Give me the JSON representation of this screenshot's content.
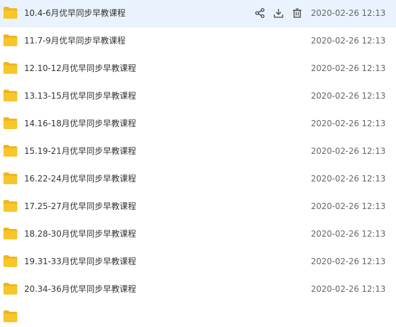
{
  "files": [
    {
      "name": "10.4-6月优早同步早教课程",
      "date": "2020-02-26 12:13"
    },
    {
      "name": "11.7-9月优早同步早教课程",
      "date": "2020-02-26 12:13"
    },
    {
      "name": "12.10-12月优早同步早教课程",
      "date": "2020-02-26 12:13"
    },
    {
      "name": "13.13-15月优早同步早教课程",
      "date": "2020-02-26 12:13"
    },
    {
      "name": "14.16-18月优早同步早教课程",
      "date": "2020-02-26 12:13"
    },
    {
      "name": "15.19-21月优早同步早教课程",
      "date": "2020-02-26 12:13"
    },
    {
      "name": "16.22-24月优早同步早教课程",
      "date": "2020-02-26 12:13"
    },
    {
      "name": "17.25-27月优早同步早教课程",
      "date": "2020-02-26 12:13"
    },
    {
      "name": "18.28-30月优早同步早教课程",
      "date": "2020-02-26 12:13"
    },
    {
      "name": "19.31-33月优早同步早教课程",
      "date": "2020-02-26 12:13"
    },
    {
      "name": "20.34-36月优早同步早教课程",
      "date": "2020-02-26 12:13"
    }
  ],
  "row_actions": {
    "share_icon": "share-icon",
    "download_icon": "download-icon",
    "delete_icon": "trash-icon"
  },
  "colors": {
    "folder": "#f8c62b",
    "folder_dark": "#f1b51c",
    "selected_row": "#e8f3fd",
    "action_icon": "#444444"
  }
}
